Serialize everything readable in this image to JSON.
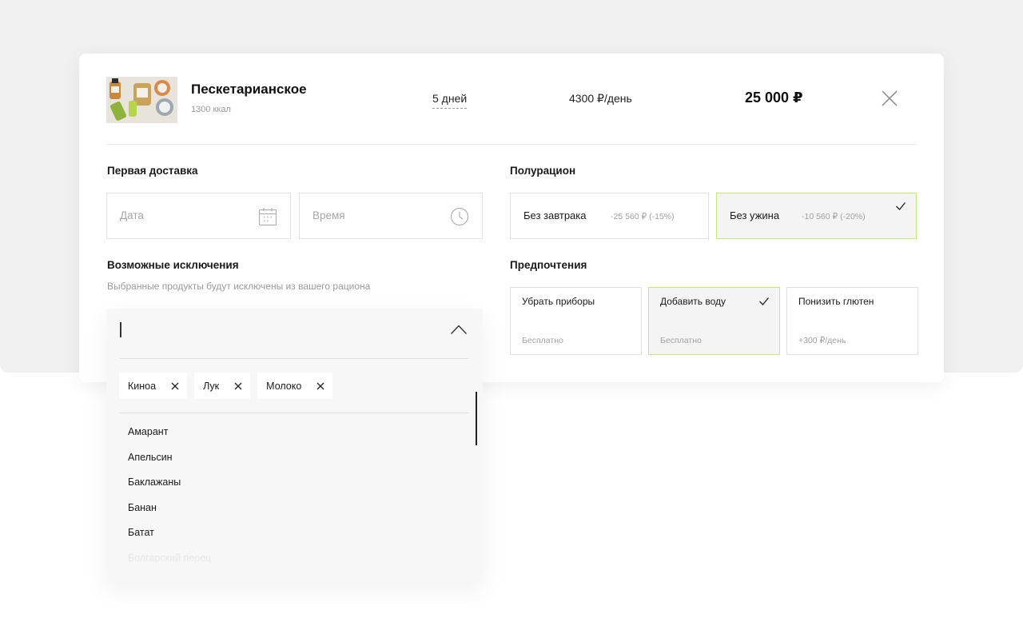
{
  "product": {
    "name": "Пескетарианское",
    "kcal": "1300 ккал",
    "days": "5 дней",
    "price_per_day": "4300 ₽/день",
    "total": "25 000 ₽"
  },
  "delivery": {
    "title": "Первая доставка",
    "date_placeholder": "Дата",
    "time_placeholder": "Время"
  },
  "half_ration": {
    "title": "Полурацион",
    "options": [
      {
        "label": "Без завтрака",
        "price": "-25 560 ₽ (-15%)",
        "selected": false
      },
      {
        "label": "Без ужина",
        "price": "-10 560 ₽ (-20%)",
        "selected": true
      }
    ]
  },
  "exclusions": {
    "title": "Возможные исключения",
    "subtitle": "Выбранные продукты будут исключены из вашего рациона",
    "selected": [
      "Киноа",
      "Лук",
      "Молоко"
    ],
    "list": [
      "Амарант",
      "Апельсин",
      "Баклажаны",
      "Банан",
      "Батат",
      "Болгарский перец"
    ]
  },
  "preferences": {
    "title": "Предпочтения",
    "options": [
      {
        "label": "Убрать приборы",
        "price": "Бесплатно",
        "selected": false
      },
      {
        "label": "Добавить воду",
        "price": "Бесплатно",
        "selected": true
      },
      {
        "label": "Понизить глютен",
        "price": "+300 ₽/день",
        "selected": false
      }
    ]
  },
  "colors": {
    "accent_border": "#c5e87a",
    "muted_text": "#9a9a9a"
  }
}
